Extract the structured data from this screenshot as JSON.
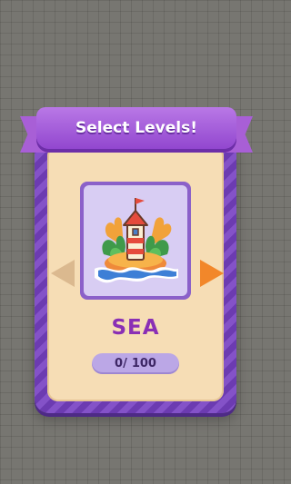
{
  "header": {
    "title": "Select Levels!"
  },
  "level": {
    "name": "SEA",
    "icon": "lighthouse-island-icon",
    "progress_current": "0/",
    "progress_total": "100"
  },
  "colors": {
    "panel_purple": "#8452c8",
    "ribbon_purple": "#a85fd6",
    "inner_cream": "#f6ddb5",
    "title_text": "#8a2fb5",
    "arrow_active": "#f2872a",
    "arrow_inactive": "#dbb98f"
  }
}
